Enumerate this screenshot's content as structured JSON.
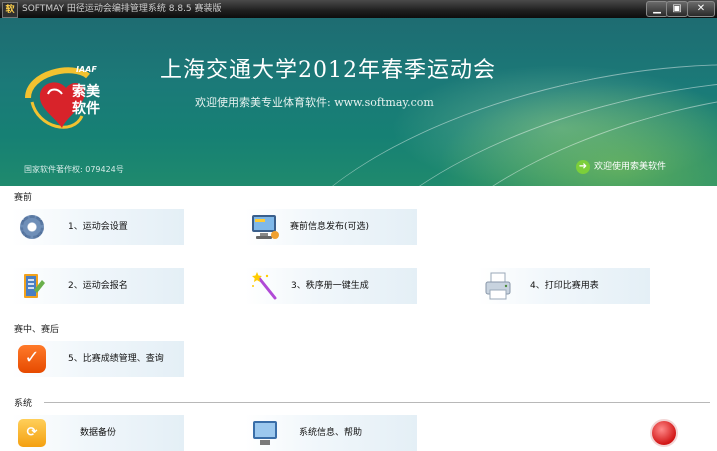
{
  "window": {
    "app_icon": "软",
    "title": "SOFTMAY 田径运动会编排管理系统 8.8.5 赛装版",
    "min_label": "▁",
    "max_label": "▣",
    "close_label": "✕"
  },
  "banner": {
    "logo_iaaf": "IAAF",
    "logo_name": "索美软件",
    "title": "上海交通大学2012年春季运动会",
    "subtitle": "欢迎使用索美专业体育软件: www.softmay.com",
    "copyright": "国家软件著作权: 079424号",
    "welcome_link": "欢迎使用索美软件"
  },
  "sections": {
    "pre": "赛前",
    "during": "赛中、赛后",
    "system": "系统"
  },
  "tiles": {
    "setup": "1、运动会设置",
    "publish": "赛前信息发布(可选)",
    "registration": "2、运动会报名",
    "program": "3、秩序册一键生成",
    "print": "4、打印比赛用表",
    "results": "5、比赛成绩管理、查询",
    "backup": "数据备份",
    "sysinfo": "系统信息、帮助"
  },
  "colors": {
    "banner": "#1b7a78",
    "accent_green": "#7ccf3a",
    "tile_tint": "#e4eff6"
  }
}
